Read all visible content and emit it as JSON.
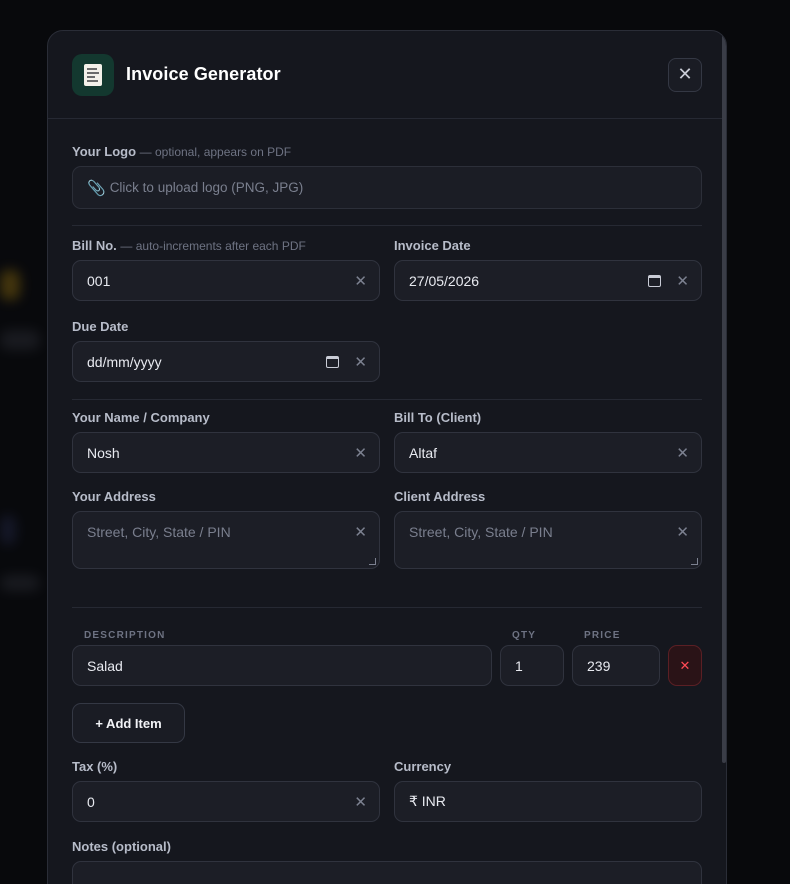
{
  "header": {
    "title": "Invoice Generator",
    "close_glyph": "✕",
    "icon": "receipt-icon"
  },
  "logo": {
    "label": "Your Logo",
    "hint": "— optional, appears on PDF",
    "upload_text": "Click to upload logo (PNG, JPG)",
    "icon": "paperclip-icon"
  },
  "bill_no": {
    "label": "Bill No.",
    "hint": "— auto-increments after each PDF",
    "value": "001"
  },
  "invoice_date": {
    "label": "Invoice Date",
    "value": "27/05/2026"
  },
  "due_date": {
    "label": "Due Date",
    "placeholder": "dd/mm/yyyy"
  },
  "your_name": {
    "label": "Your Name / Company",
    "value": "Nosh"
  },
  "bill_to": {
    "label": "Bill To (Client)",
    "value": "Altaf"
  },
  "your_address": {
    "label": "Your Address",
    "placeholder": "Street, City, State / PIN"
  },
  "client_address": {
    "label": "Client Address",
    "placeholder": "Street, City, State / PIN"
  },
  "items": {
    "columns": {
      "description": "DESCRIPTION",
      "qty": "QTY",
      "price": "PRICE"
    },
    "rows": [
      {
        "description": "Salad",
        "qty": "1",
        "price": "239"
      }
    ],
    "delete_glyph": "✕",
    "add_label": "+ Add Item"
  },
  "tax": {
    "label": "Tax (%)",
    "value": "0"
  },
  "currency": {
    "label": "Currency",
    "value": "₹ INR"
  },
  "notes": {
    "label": "Notes (optional)"
  },
  "clear_glyph": "✕",
  "colors": {
    "accent_icon_bg": "#13382f",
    "delete": "#ff4a55",
    "surface": "#15171e"
  }
}
